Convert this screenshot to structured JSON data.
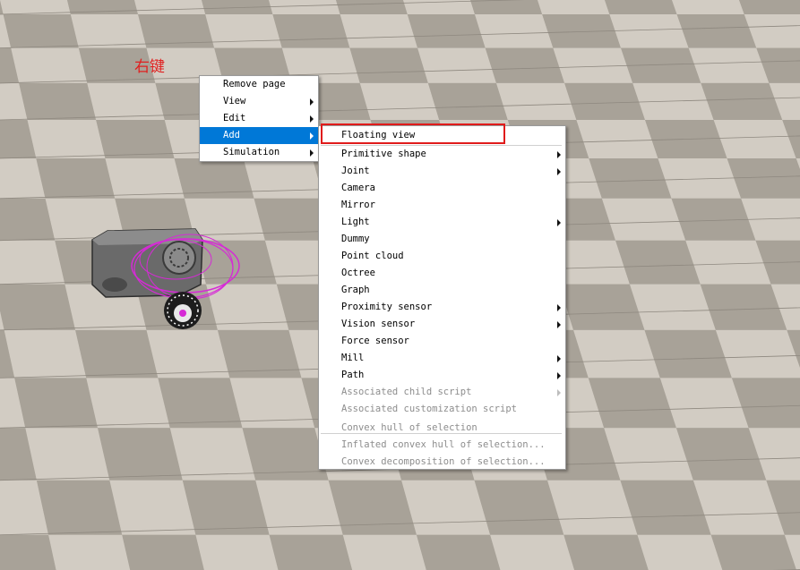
{
  "annotation": "右键",
  "main_menu": {
    "items": [
      {
        "label": "Remove page",
        "submenu": false,
        "selected": false
      },
      {
        "label": "View",
        "submenu": true,
        "selected": false
      },
      {
        "label": "Edit",
        "submenu": true,
        "selected": false
      },
      {
        "label": "Add",
        "submenu": true,
        "selected": true
      },
      {
        "label": "Simulation",
        "submenu": true,
        "selected": false
      }
    ]
  },
  "add_menu": {
    "items": [
      {
        "label": "Floating view",
        "submenu": false,
        "disabled": false
      },
      {
        "label": "Primitive shape",
        "submenu": true,
        "disabled": false
      },
      {
        "label": "Joint",
        "submenu": true,
        "disabled": false
      },
      {
        "label": "Camera",
        "submenu": false,
        "disabled": false
      },
      {
        "label": "Mirror",
        "submenu": false,
        "disabled": false
      },
      {
        "label": "Light",
        "submenu": true,
        "disabled": false
      },
      {
        "label": "Dummy",
        "submenu": false,
        "disabled": false
      },
      {
        "label": "Point cloud",
        "submenu": false,
        "disabled": false
      },
      {
        "label": "Octree",
        "submenu": false,
        "disabled": false
      },
      {
        "label": "Graph",
        "submenu": false,
        "disabled": false
      },
      {
        "label": "Proximity sensor",
        "submenu": true,
        "disabled": false
      },
      {
        "label": "Vision sensor",
        "submenu": true,
        "disabled": false
      },
      {
        "label": "Force sensor",
        "submenu": false,
        "disabled": false
      },
      {
        "label": "Mill",
        "submenu": true,
        "disabled": false
      },
      {
        "label": "Path",
        "submenu": true,
        "disabled": false
      },
      {
        "label": "Associated child script",
        "submenu": true,
        "disabled": true
      },
      {
        "label": "Associated customization script",
        "submenu": false,
        "disabled": true
      },
      {
        "label": "Convex hull of selection",
        "submenu": false,
        "disabled": true
      },
      {
        "label": "Inflated convex hull of selection...",
        "submenu": false,
        "disabled": true
      },
      {
        "label": "Convex decomposition of selection...",
        "submenu": false,
        "disabled": true
      }
    ]
  },
  "colors": {
    "highlight": "#0078d7",
    "annotation_red": "#e02020",
    "floor_light": "#d2ccc3",
    "floor_dark": "#a8a298",
    "robot_gray": "#6e6e6e",
    "magenta": "#d62ad6"
  }
}
